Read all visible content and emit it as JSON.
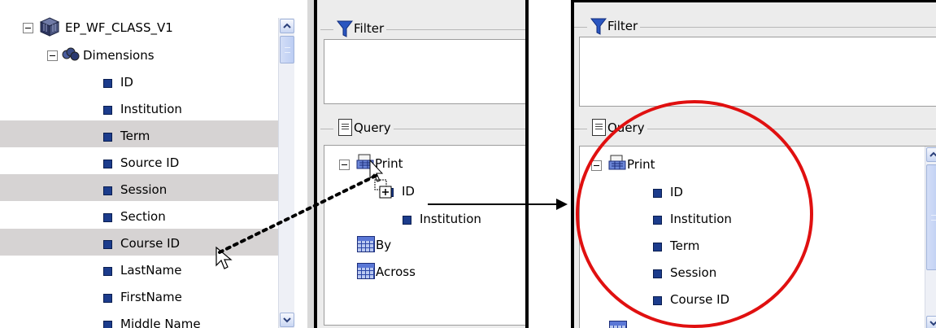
{
  "left_tree": {
    "root_label": "EP_WF_CLASS_V1",
    "dimensions_label": "Dimensions",
    "fields": [
      "ID",
      "Institution",
      "Term",
      "Source ID",
      "Session",
      "Section",
      "Course ID",
      "LastName",
      "FirstName",
      "Middle Name"
    ],
    "highlighted": [
      "Term",
      "Session",
      "Course ID"
    ]
  },
  "middle": {
    "filter_title": "Filter",
    "query_title": "Query",
    "print_label": "Print",
    "print_fields": [
      "ID",
      "Institution"
    ],
    "by_label": "By",
    "across_label": "Across"
  },
  "right": {
    "filter_title": "Filter",
    "query_title": "Query",
    "print_label": "Print",
    "print_fields": [
      "ID",
      "Institution",
      "Term",
      "Session",
      "Course ID"
    ]
  },
  "colors": {
    "highlight_circle": "#e01010",
    "row_highlight": "#d6d3d3",
    "field_icon": "#1c3c8c"
  },
  "icons": {
    "cube": "cube-icon",
    "dimensions": "dimensions-icon",
    "field": "field-icon",
    "filter": "funnel-icon",
    "query": "document-icon",
    "print": "print-icon",
    "grid": "grid-icon",
    "cursor": "drag-cursor-icon"
  }
}
